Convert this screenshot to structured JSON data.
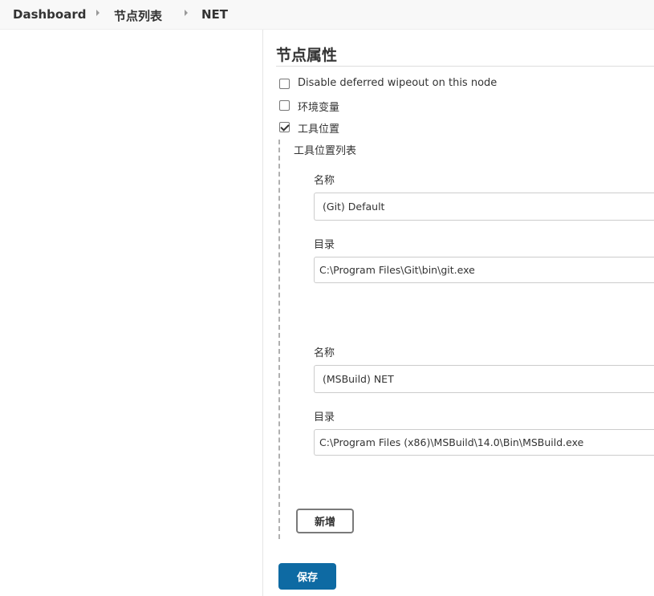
{
  "breadcrumb": {
    "items": [
      {
        "label": "Dashboard"
      },
      {
        "label": "节点列表"
      },
      {
        "label": "NET"
      }
    ]
  },
  "section": {
    "title": "节点属性"
  },
  "properties": {
    "disable_wipeout": {
      "label": "Disable deferred wipeout on this node",
      "checked": false
    },
    "env_vars": {
      "label": "环境变量",
      "checked": false
    },
    "tool_locations": {
      "label": "工具位置",
      "checked": true
    }
  },
  "tool_list": {
    "title": "工具位置列表",
    "entries": [
      {
        "name_label": "名称",
        "name_value": "(Git) Default",
        "home_label": "目录",
        "home_value": "C:\\Program Files\\Git\\bin\\git.exe"
      },
      {
        "name_label": "名称",
        "name_value": "(MSBuild) NET",
        "home_label": "目录",
        "home_value": "C:\\Program Files (x86)\\MSBuild\\14.0\\Bin\\MSBuild.exe"
      }
    ],
    "add_label": "新增"
  },
  "actions": {
    "save_label": "保存"
  },
  "colors": {
    "primary_button": "#0e6aa3",
    "breadcrumb_background": "#f8f8f8"
  }
}
